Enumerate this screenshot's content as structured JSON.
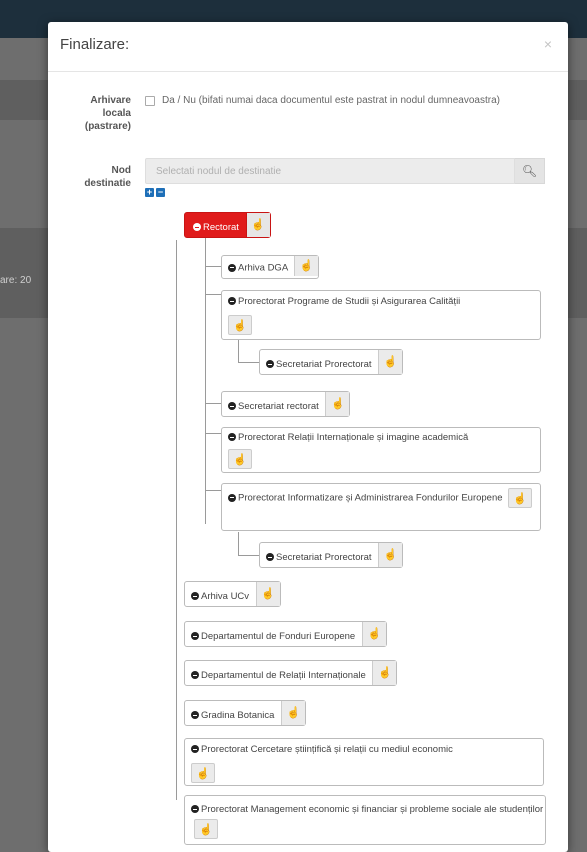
{
  "background": {
    "partial_label": "are: 20"
  },
  "modal": {
    "title": "Finalizare:",
    "close_symbol": "×",
    "archive_label": "Arhivare locala (pastrare)",
    "archive_checkbox_label": "Da / Nu (bifati numai daca documentul este pastrat in nodul dumneavoastra)",
    "dest_label": "Nod destinatie",
    "dest_placeholder": "Selectati nodul de destinatie",
    "expand_all": "+",
    "collapse_all": "−"
  },
  "tree": {
    "root": "Rectorat",
    "hand_symbol": "☝",
    "nodes": [
      "Arhiva DGA",
      "Prorectorat Programe de Studii și Asigurarea Calității",
      "Secretariat Prorectorat",
      "Secretariat rectorat",
      "Prorectorat Relații Internaționale și imagine academică",
      "Prorectorat Informatizare și Administrarea Fondurilor Europene",
      "Secretariat Prorectorat",
      "Arhiva UCv",
      "Departamentul de Fonduri Europene",
      "Departamentul de Relații Internaționale",
      "Gradina Botanica",
      "Prorectorat Cercetare științifică și relații cu mediul economic",
      "Prorectorat Management economic și financiar și probleme sociale ale studenților"
    ]
  },
  "colors": {
    "root_node": "#e01b1b",
    "top_bar": "#1d2f3c",
    "expand_button": "#1e6fb8"
  }
}
